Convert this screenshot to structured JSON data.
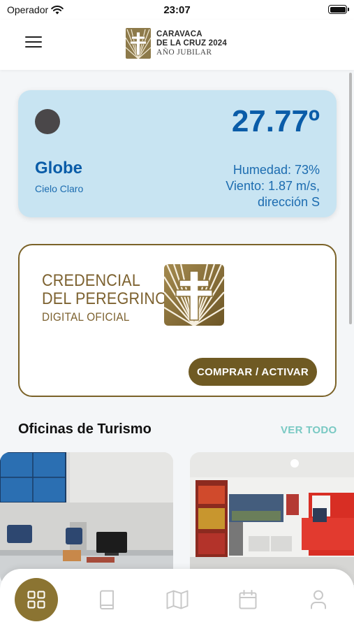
{
  "status_bar": {
    "carrier": "Operador",
    "time": "23:07",
    "icons": [
      "wifi-icon",
      "battery-icon"
    ]
  },
  "header": {
    "menu_icon": "hamburger-menu-icon",
    "logo": {
      "line1": "CARAVACA",
      "line2": "DE LA CRUZ 2024",
      "line3": "AÑO JUBILAR",
      "icon": "caravaca-cross-icon"
    }
  },
  "weather": {
    "icon": "weather-condition-icon",
    "temperature": "27.77º",
    "city": "Globe",
    "condition": "Cielo Claro",
    "humidity": "Humedad: 73%",
    "wind": "Viento: 1.87 m/s,",
    "direction": "dirección S",
    "colors": {
      "background": "#c8e4f2",
      "text": "#0a5ca8"
    }
  },
  "credential": {
    "line1": "CREDENCIAL",
    "line2": "DEL PEREGRINO",
    "line3": "DIGITAL OFICIAL",
    "button_label": "COMPRAR / ACTIVAR",
    "icon": "caravaca-cross-icon",
    "colors": {
      "border": "#7a6228",
      "button": "#6f5a23"
    }
  },
  "tourism": {
    "title": "Oficinas de Turismo",
    "see_all": "VER TODO",
    "see_all_color": "#79c9c3"
  },
  "bottom_nav": {
    "items": [
      {
        "icon": "grid-icon",
        "active": true
      },
      {
        "icon": "book-icon",
        "active": false
      },
      {
        "icon": "map-icon",
        "active": false
      },
      {
        "icon": "calendar-icon",
        "active": false
      },
      {
        "icon": "user-icon",
        "active": false
      }
    ],
    "active_color": "#8b7432"
  }
}
